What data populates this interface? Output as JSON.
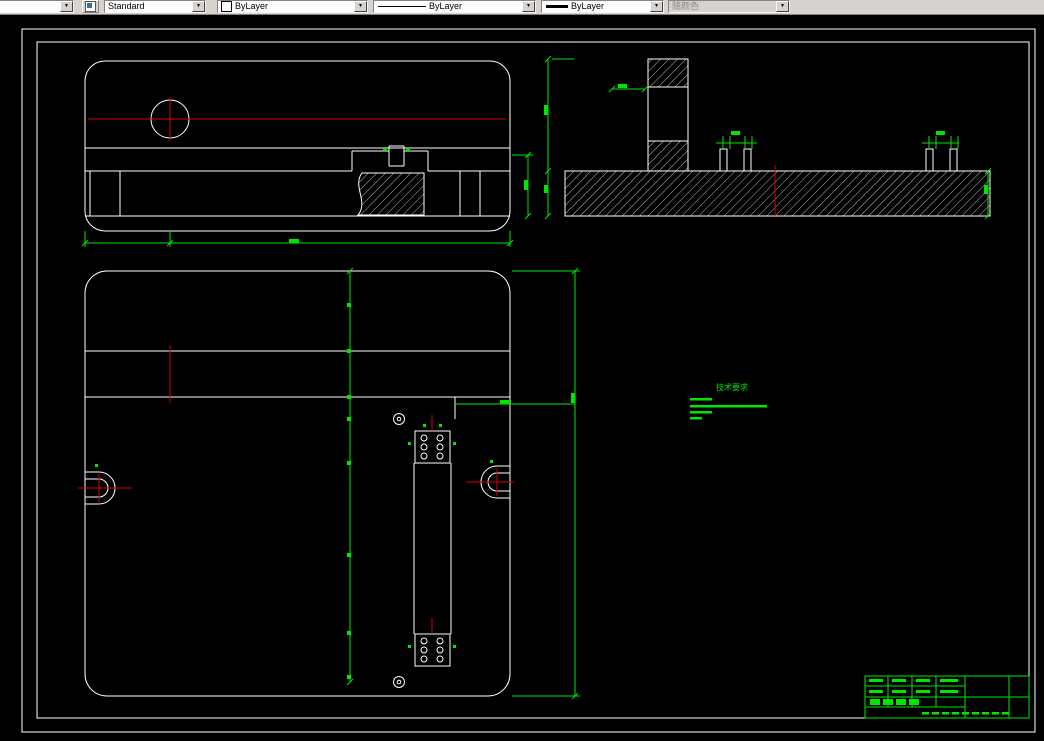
{
  "toolbar": {
    "layer": {
      "value": ""
    },
    "style": {
      "value": "Standard"
    },
    "color": {
      "value": "ByLayer"
    },
    "linetype": {
      "value": "ByLayer"
    },
    "lineweight": {
      "value": "ByLayer"
    },
    "plot_style": {
      "value": "随颜色"
    },
    "dropdown_arrow": "▼"
  },
  "drawing": {
    "notes_title": "技术要求",
    "colors": {
      "outline": "#ffffff",
      "dimension": "#00e600",
      "centerline": "#d60000",
      "background": "#000000"
    }
  }
}
